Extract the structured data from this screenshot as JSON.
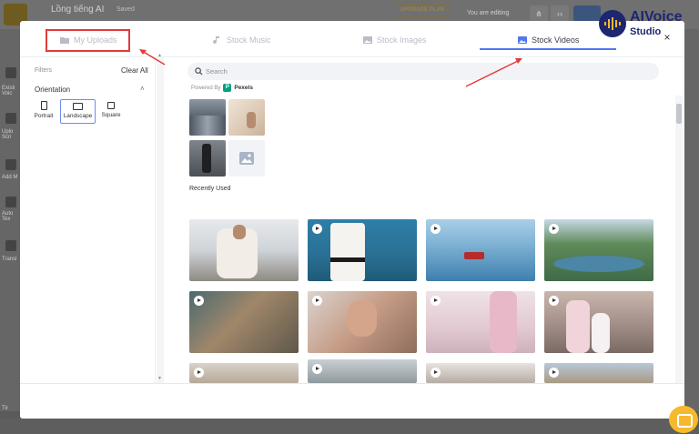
{
  "app": {
    "title": "Lồng tiếng AI",
    "saved": "Saved",
    "upgrade_label": "UPGRADE PLAN",
    "editing_label": "You are editing",
    "sidebar": [
      "Existi Voic",
      "Uplo Scri",
      "Add M",
      "Auto Tex",
      "Transl"
    ],
    "bottom_label": "Tir"
  },
  "modal": {
    "tabs": [
      {
        "label": "My Uploads",
        "icon": "folder-icon",
        "active": false
      },
      {
        "label": "Stock Music",
        "icon": "music-note-icon",
        "active": false
      },
      {
        "label": "Stock Images",
        "icon": "image-icon",
        "active": false
      },
      {
        "label": "Stock Videos",
        "icon": "video-icon",
        "active": true
      }
    ],
    "close_label": "×"
  },
  "filters": {
    "label": "Filters",
    "clear_all": "Clear All",
    "orientation_label": "Orientation",
    "options": [
      {
        "label": "Portrait",
        "selected": false
      },
      {
        "label": "Landscape",
        "selected": true
      },
      {
        "label": "Square",
        "selected": false
      }
    ]
  },
  "search": {
    "placeholder": "Search",
    "value": "",
    "powered_by": "Powered By",
    "provider": "Pexels"
  },
  "recently_used": {
    "label": "Recently Used",
    "count": 4
  },
  "videos": {
    "rows": 3,
    "columns": 4
  },
  "brand": {
    "line1": "AIVoice",
    "line2": "Studio"
  },
  "colors": {
    "accent": "#4f78f0",
    "annotation": "#e23b3b",
    "brand": "#1d2670",
    "pexels": "#05a081"
  }
}
